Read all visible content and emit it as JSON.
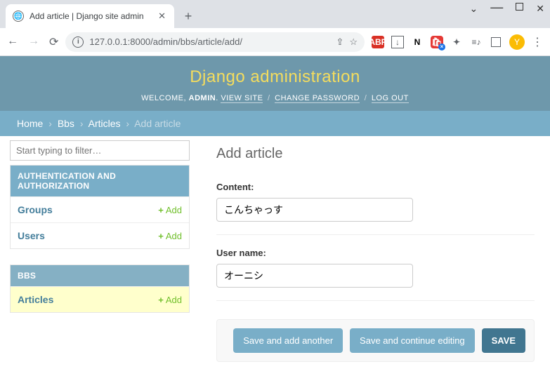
{
  "browser": {
    "tab_title": "Add article | Django site admin",
    "url": "127.0.0.1:8000/admin/bbs/article/add/",
    "avatar_letter": "Y"
  },
  "header": {
    "title": "Django administration",
    "welcome": "WELCOME,",
    "user": "ADMIN",
    "view_site": "VIEW SITE",
    "change_password": "CHANGE PASSWORD",
    "logout": "LOG OUT"
  },
  "breadcrumbs": {
    "home": "Home",
    "app": "Bbs",
    "model": "Articles",
    "current": "Add article"
  },
  "sidebar": {
    "filter_placeholder": "Start typing to filter…",
    "auth_caption": "AUTHENTICATION AND AUTHORIZATION",
    "groups": "Groups",
    "users": "Users",
    "bbs_caption": "BBS",
    "articles": "Articles",
    "add_label": "Add"
  },
  "form": {
    "title": "Add article",
    "content_label": "Content:",
    "content_value": "こんちゃっす",
    "username_label": "User name:",
    "username_value": "オーニシ",
    "save_add_another": "Save and add another",
    "save_continue": "Save and continue editing",
    "save": "SAVE"
  }
}
